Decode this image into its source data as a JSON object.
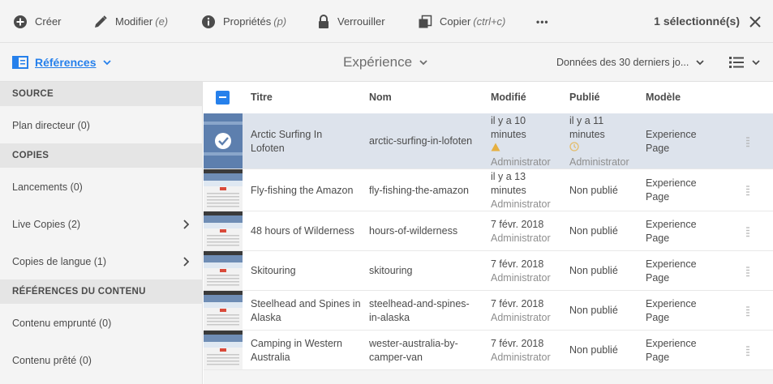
{
  "actions": {
    "create": {
      "label": "Créer"
    },
    "edit": {
      "label": "Modifier",
      "shortcut": "(e)"
    },
    "properties": {
      "label": "Propriétés",
      "shortcut": "(p)"
    },
    "lock": {
      "label": "Verrouiller"
    },
    "copy": {
      "label": "Copier",
      "shortcut": "(ctrl+c)"
    },
    "more": {
      "label": "•••"
    },
    "selection": "1 sélectionné(s)"
  },
  "header": {
    "rail_label": "Références",
    "title": "Expérience",
    "filter": "Données des 30 derniers jo..."
  },
  "sidebar": {
    "source_head": "SOURCE",
    "blueprint": "Plan directeur (0)",
    "copies_head": "COPIES",
    "launches": "Lancements (0)",
    "live_copies": "Live Copies (2)",
    "language_copies": "Copies de langue (1)",
    "content_refs_head": "RÉFÉRENCES DU CONTENU",
    "borrowed": "Contenu emprunté (0)",
    "lent": "Contenu prêté (0)"
  },
  "table": {
    "columns": {
      "title": "Titre",
      "name": "Nom",
      "modified": "Modifié",
      "published": "Publié",
      "template": "Modèle"
    },
    "rows": [
      {
        "title": [
          "Arctic Surfing In",
          "Lofoten"
        ],
        "name": [
          "arctic-surfing-in-lofoten"
        ],
        "modified": [
          "il y a 10",
          "minutes"
        ],
        "modified_by": "Administrator",
        "published": [
          "il y a 11",
          "minutes"
        ],
        "published_by": "Administrator",
        "template": [
          "Experience",
          "Page"
        ]
      },
      {
        "title": [
          "Fly-fishing the Amazon"
        ],
        "name": [
          "fly-fishing-the-amazon"
        ],
        "modified": [
          "il y a 13",
          "minutes"
        ],
        "modified_by": "Administrator",
        "published": [
          "Non publié"
        ],
        "published_by": "",
        "template": [
          "Experience",
          "Page"
        ]
      },
      {
        "title": [
          "48 hours of Wilderness"
        ],
        "name": [
          "hours-of-wilderness"
        ],
        "modified": [
          "7 févr. 2018"
        ],
        "modified_by": "Administrator",
        "published": [
          "Non publié"
        ],
        "published_by": "",
        "template": [
          "Experience",
          "Page"
        ]
      },
      {
        "title": [
          "Skitouring"
        ],
        "name": [
          "skitouring"
        ],
        "modified": [
          "7 févr. 2018"
        ],
        "modified_by": "Administrator",
        "published": [
          "Non publié"
        ],
        "published_by": "",
        "template": [
          "Experience",
          "Page"
        ]
      },
      {
        "title": [
          "Steelhead and Spines in",
          "Alaska"
        ],
        "name": [
          "steelhead-and-spines-",
          "in-alaska"
        ],
        "modified": [
          "7 févr. 2018"
        ],
        "modified_by": "Administrator",
        "published": [
          "Non publié"
        ],
        "published_by": "",
        "template": [
          "Experience",
          "Page"
        ]
      },
      {
        "title": [
          "Camping in Western",
          "Australia"
        ],
        "name": [
          "wester-australia-by-",
          "camper-van"
        ],
        "modified": [
          "7 févr. 2018"
        ],
        "modified_by": "Administrator",
        "published": [
          "Non publié"
        ],
        "published_by": "",
        "template": [
          "Experience",
          "Page"
        ]
      }
    ]
  },
  "colors": {
    "accent": "#2680eb",
    "selected_row": "#dde3ec",
    "warning": "#e8a317"
  }
}
